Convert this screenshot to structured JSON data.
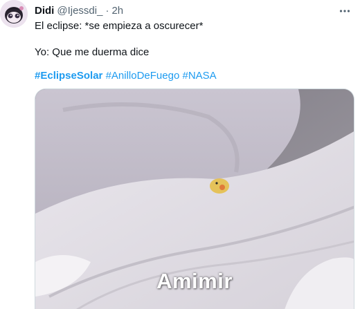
{
  "author": {
    "name": "Didi",
    "handle": "@Ijessdi_",
    "separator": "·",
    "time": "2h"
  },
  "tweet": {
    "line1": "El eclipse: *se empieza a oscurecer*",
    "line2": "Yo: Que me duerma dice",
    "hashtags": [
      "#EclipseSolar",
      "#AnilloDeFuego",
      "#NASA"
    ]
  },
  "media": {
    "caption": "Amimir"
  },
  "icons": {
    "avatar": "avatar-icon",
    "more": "more-options-icon"
  },
  "colors": {
    "accent": "#1d9bf0",
    "text": "#0f1419",
    "secondary": "#536471"
  }
}
